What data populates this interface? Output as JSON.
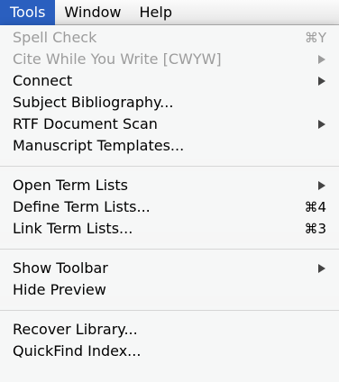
{
  "menubar": {
    "items": [
      "Tools",
      "Window",
      "Help"
    ],
    "active": "Tools"
  },
  "tools_menu": {
    "groups": [
      [
        {
          "label": "Spell Check",
          "enabled": false,
          "shortcut": "⌘Y"
        },
        {
          "label": "Cite While You Write [CWYW]",
          "enabled": false,
          "submenu": true
        },
        {
          "label": "Connect",
          "enabled": true,
          "submenu": true
        },
        {
          "label": "Subject Bibliography...",
          "enabled": true
        },
        {
          "label": "RTF Document Scan",
          "enabled": true,
          "submenu": true
        },
        {
          "label": "Manuscript Templates...",
          "enabled": true
        }
      ],
      [
        {
          "label": "Open Term Lists",
          "enabled": true,
          "submenu": true
        },
        {
          "label": "Define Term Lists...",
          "enabled": true,
          "shortcut": "⌘4"
        },
        {
          "label": "Link Term Lists...",
          "enabled": true,
          "shortcut": "⌘3"
        }
      ],
      [
        {
          "label": "Show Toolbar",
          "enabled": true,
          "submenu": true
        },
        {
          "label": "Hide Preview",
          "enabled": true
        }
      ],
      [
        {
          "label": "Recover Library...",
          "enabled": true
        },
        {
          "label": "QuickFind Index...",
          "enabled": true
        }
      ]
    ]
  },
  "colors": {
    "menu_highlight": "#2a5fbf",
    "disabled_text": "#9c9c9c"
  }
}
